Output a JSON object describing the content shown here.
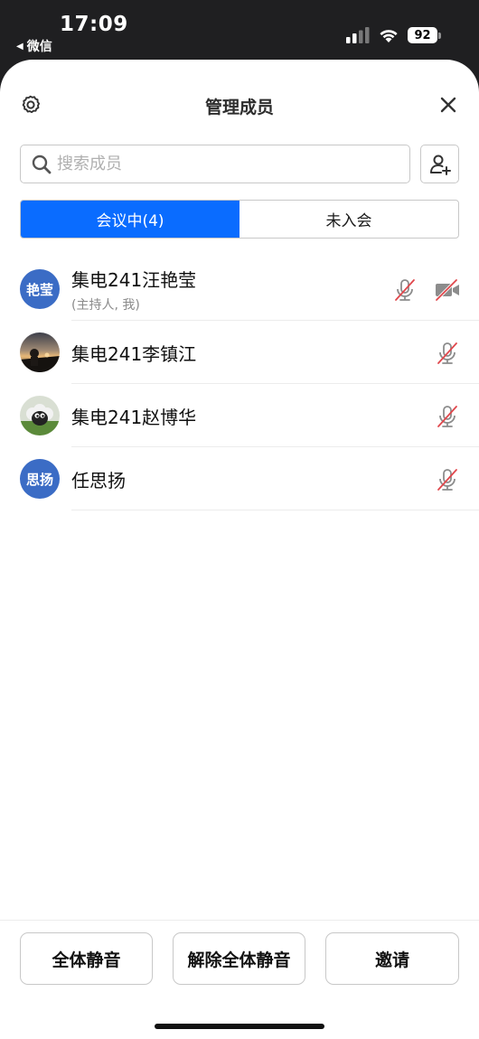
{
  "status_bar": {
    "time": "17:09",
    "back_label": "微信",
    "battery": "92"
  },
  "header": {
    "title": "管理成员"
  },
  "search": {
    "placeholder": "搜索成员"
  },
  "tabs": [
    {
      "label": "会议中(4)",
      "active": true
    },
    {
      "label": "未入会",
      "active": false
    }
  ],
  "members": [
    {
      "name": "集电241汪艳莹",
      "sub": "(主持人, 我)",
      "avatar_text": "艳莹",
      "mic": "muted",
      "camera": "off"
    },
    {
      "name": "集电241李镇江",
      "avatar_image": "sunset-photo",
      "mic": "muted"
    },
    {
      "name": "集电241赵博华",
      "avatar_image": "black-sheep-photo",
      "mic": "muted"
    },
    {
      "name": "任思扬",
      "avatar_text": "思扬",
      "mic": "muted"
    }
  ],
  "footer": {
    "mute_all": "全体静音",
    "unmute_all": "解除全体静音",
    "invite": "邀请"
  },
  "colors": {
    "accent": "#0a6cff",
    "avatar_bg": "#3b6cc5",
    "muted_slash": "#e0474c"
  }
}
